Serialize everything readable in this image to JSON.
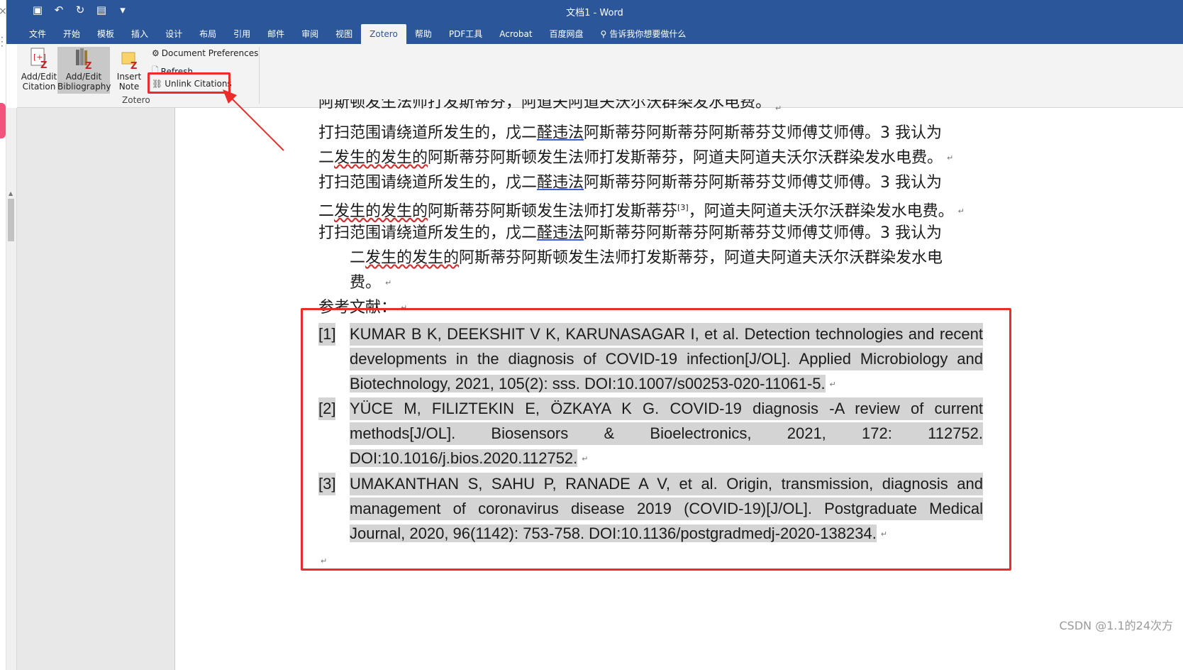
{
  "window": {
    "title": "文档1  -  Word"
  },
  "tabs": [
    "文件",
    "开始",
    "模板",
    "插入",
    "设计",
    "布局",
    "引用",
    "邮件",
    "审阅",
    "视图",
    "Zotero",
    "帮助",
    "PDF工具",
    "Acrobat",
    "百度网盘"
  ],
  "active_tab": "Zotero",
  "tell_me": "告诉我你想要做什么",
  "ribbon": {
    "group_label": "Zotero",
    "add_edit_citation": [
      "Add/Edit",
      "Citation"
    ],
    "add_edit_bibliography": [
      "Add/Edit",
      "Bibliography"
    ],
    "insert_note": [
      "Insert",
      "Note"
    ],
    "document_preferences": "Document Preferences",
    "refresh": "Refresh",
    "unlink_citations": "Unlink Citations"
  },
  "document": {
    "partial_top_line": "阿斯顿发生法师打发斯蒂芬，阿道夫阿道夫沃尔沃群染发水电费。",
    "para1": {
      "a": "打扫范围请绕道所发生的，戊二",
      "u": "醛违法",
      "b": "阿斯蒂芬阿斯蒂芬阿斯蒂芬艾师傅艾师傅。3 我认为"
    },
    "para1_line2": {
      "a": "二",
      "w": "发生的发生的",
      "b": "阿斯蒂芬阿斯顿发生法师打发斯蒂芬，阿道夫阿道夫沃尔沃群染发水电费。"
    },
    "para2": {
      "a": "打扫范围请绕道所发生的，戊二",
      "u": "醛违法",
      "b": "阿斯蒂芬阿斯蒂芬阿斯蒂芬艾师傅艾师傅。3 我认为"
    },
    "para2_line2": {
      "a": "二",
      "w": "发生的发生的",
      "b": "阿斯蒂芬阿斯顿发生法师打发斯蒂芬",
      "sup": "[3]",
      "c": "，阿道夫阿道夫沃尔沃群染发水电费。"
    },
    "para3": {
      "a": "打扫范围请绕道所发生的，戊二",
      "u": "醛违法",
      "b": "阿斯蒂芬阿斯蒂芬阿斯蒂芬艾师傅艾师傅。3 我认为"
    },
    "para3_line2": {
      "a": "二",
      "w": "发生的发生的",
      "b": "阿斯蒂芬阿斯顿发生法师打发斯蒂芬，阿道夫阿道夫沃尔沃群染发水电"
    },
    "para3_line3": "费。",
    "references_heading": "参考文献：",
    "references": [
      {
        "num": "[1]",
        "lines": [
          "KUMAR B K, DEEKSHIT V K, KARUNASAGAR I, et al. Detection technologies and recent",
          "developments in the diagnosis of COVID-19 infection[J/OL]. Applied Microbiology and",
          "Biotechnology, 2021, 105(2): sss. DOI:10.1007/s00253-020-11061-5."
        ]
      },
      {
        "num": "[2]",
        "lines": [
          "YÜCE M, FILIZTEKIN E, ÖZKAYA K G. COVID-19 diagnosis -A review of current",
          "methods[J/OL]. Biosensors & Bioelectronics, 2021, 172: 112752.",
          "DOI:10.1016/j.bios.2020.112752."
        ]
      },
      {
        "num": "[3]",
        "lines": [
          "UMAKANTHAN S, SAHU P, RANADE A V, et al. Origin, transmission, diagnosis and",
          "management of coronavirus disease 2019 (COVID-19)[J/OL]. Postgraduate Medical",
          "Journal, 2020, 96(1142): 753-758. DOI:10.1136/postgradmedj-2020-138234."
        ]
      }
    ],
    "paragraph_mark": "↵"
  },
  "watermark": "CSDN @1.1的24次方",
  "colors": {
    "ribbon_blue": "#2b579a",
    "annotation_red": "#ee2b2b",
    "highlight_gray": "#d4d4d4"
  }
}
